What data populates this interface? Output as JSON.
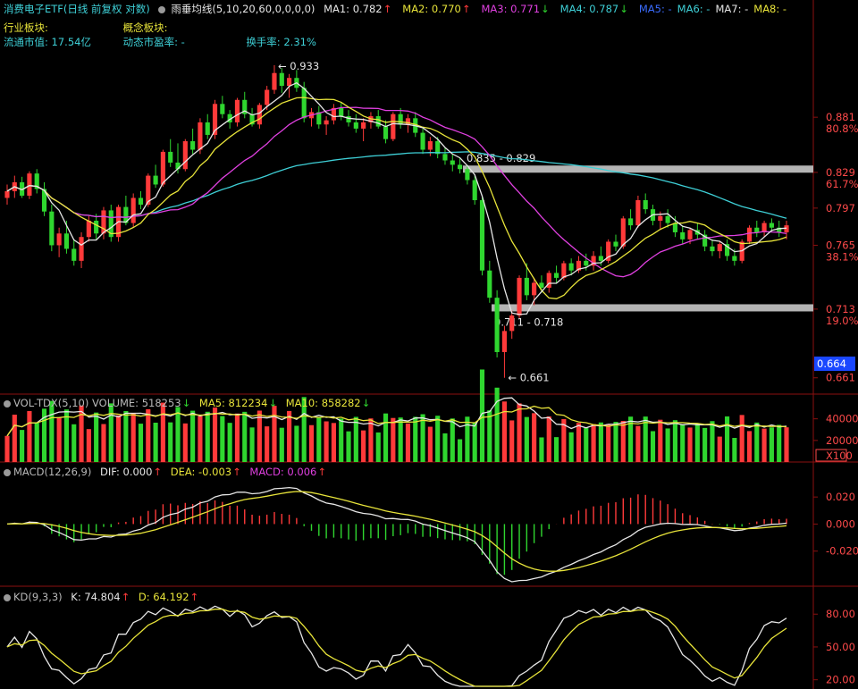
{
  "header": {
    "title": "消费电子ETF",
    "mode": "(日线 前复权 对数)",
    "indicator": "雨垂均线",
    "params": "(5,10,20,60,0,0,0,0)",
    "ma": [
      {
        "label": "MA1: 0.782",
        "arrow": "↑",
        "color": "#e6e6e6"
      },
      {
        "label": "MA2: 0.770",
        "arrow": "↑",
        "color": "#e8e43a"
      },
      {
        "label": "MA3: 0.771",
        "arrow": "↓",
        "color": "#e040e0"
      },
      {
        "label": "MA4: 0.787",
        "arrow": "↓",
        "color": "#3ecfd6"
      },
      {
        "label": "MA5: -",
        "arrow": "",
        "color": "#3a6cff"
      },
      {
        "label": "MA6: -",
        "arrow": "",
        "color": "#3ecfd6"
      },
      {
        "label": "MA7: -",
        "arrow": "",
        "color": "#e6e6e6"
      },
      {
        "label": "MA8: -",
        "arrow": "",
        "color": "#e8e43a"
      }
    ],
    "industry_label": "行业板块:",
    "concept_label": "概念板块:",
    "circ_mv": "流通市值: 17.54亿",
    "dyn_pe": "动态市盈率: -",
    "turnover": "换手率: 2.31%"
  },
  "price_axis": {
    "levels": [
      {
        "price": "0.881",
        "fib": "80.8%"
      },
      {
        "price": "0.829",
        "fib": "61.7%"
      },
      {
        "price": "0.797",
        "fib": ""
      },
      {
        "price": "0.765",
        "fib": "38.1%"
      },
      {
        "price": "0.713",
        "fib": "19.0%"
      },
      {
        "price": "0.661",
        "fib": ""
      }
    ],
    "current_price": "0.664"
  },
  "annotations": {
    "high": "0.933",
    "low": "0.661",
    "zone_upper": "0.835 - 0.829",
    "zone_lower": "0.711 - 0.718"
  },
  "volume_panel": {
    "name": "VOL-TDX(5,10)",
    "volume": "VOLUME: 518253",
    "volume_arrow": "↓",
    "ma5": "MA5: 812234",
    "ma5_arrow": "↓",
    "ma10": "MA10: 858282",
    "ma10_arrow": "↓",
    "ticks": [
      "40000",
      "20000"
    ],
    "unit": "X100"
  },
  "macd_panel": {
    "name": "MACD(12,26,9)",
    "dif": "DIF: 0.000",
    "dif_arrow": "↑",
    "dea": "DEA: -0.003",
    "dea_arrow": "↑",
    "macd": "MACD: 0.006",
    "macd_arrow": "↑",
    "ticks": [
      "0.020",
      "0.000",
      "-0.020"
    ]
  },
  "kd_panel": {
    "name": "KD(9,3,3)",
    "k": "K: 74.804",
    "k_arrow": "↑",
    "d": "D: 64.192",
    "d_arrow": "↑",
    "ticks": [
      "80.00",
      "50.00",
      "20.00"
    ]
  },
  "colors": {
    "up": "#ff3a3a",
    "down": "#2fd62f",
    "ma5": "#e6e6e6",
    "ma10": "#e8e43a",
    "ma20": "#e040e0",
    "ma60": "#3ecfd6",
    "grid_red": "#8b1010",
    "zone": "#b4b4b4"
  },
  "chart_data": {
    "type": "candlestick",
    "note_units": "price in CNY; candles listed left to right",
    "candles": [
      [
        0.806,
        0.818,
        0.8,
        0.812
      ],
      [
        0.812,
        0.826,
        0.806,
        0.82
      ],
      [
        0.82,
        0.825,
        0.806,
        0.808
      ],
      [
        0.808,
        0.83,
        0.805,
        0.828
      ],
      [
        0.828,
        0.832,
        0.81,
        0.814
      ],
      [
        0.814,
        0.82,
        0.79,
        0.794
      ],
      [
        0.794,
        0.8,
        0.76,
        0.765
      ],
      [
        0.765,
        0.78,
        0.755,
        0.775
      ],
      [
        0.775,
        0.786,
        0.758,
        0.762
      ],
      [
        0.762,
        0.77,
        0.748,
        0.752
      ],
      [
        0.752,
        0.776,
        0.746,
        0.772
      ],
      [
        0.772,
        0.79,
        0.768,
        0.786
      ],
      [
        0.786,
        0.792,
        0.77,
        0.775
      ],
      [
        0.775,
        0.798,
        0.77,
        0.795
      ],
      [
        0.795,
        0.8,
        0.768,
        0.772
      ],
      [
        0.772,
        0.8,
        0.768,
        0.798
      ],
      [
        0.798,
        0.808,
        0.782,
        0.784
      ],
      [
        0.784,
        0.81,
        0.78,
        0.806
      ],
      [
        0.806,
        0.812,
        0.796,
        0.8
      ],
      [
        0.8,
        0.828,
        0.798,
        0.826
      ],
      [
        0.826,
        0.836,
        0.815,
        0.818
      ],
      [
        0.818,
        0.85,
        0.816,
        0.848
      ],
      [
        0.848,
        0.86,
        0.834,
        0.838
      ],
      [
        0.838,
        0.856,
        0.828,
        0.832
      ],
      [
        0.832,
        0.86,
        0.83,
        0.858
      ],
      [
        0.858,
        0.87,
        0.846,
        0.85
      ],
      [
        0.85,
        0.88,
        0.846,
        0.876
      ],
      [
        0.876,
        0.884,
        0.86,
        0.864
      ],
      [
        0.864,
        0.898,
        0.86,
        0.894
      ],
      [
        0.894,
        0.902,
        0.88,
        0.884
      ],
      [
        0.884,
        0.888,
        0.87,
        0.876
      ],
      [
        0.876,
        0.9,
        0.872,
        0.898
      ],
      [
        0.898,
        0.906,
        0.88,
        0.884
      ],
      [
        0.884,
        0.89,
        0.872,
        0.874
      ],
      [
        0.874,
        0.895,
        0.87,
        0.893
      ],
      [
        0.893,
        0.912,
        0.888,
        0.908
      ],
      [
        0.908,
        0.933,
        0.904,
        0.925
      ],
      [
        0.925,
        0.93,
        0.905,
        0.912
      ],
      [
        0.912,
        0.924,
        0.9,
        0.92
      ],
      [
        0.92,
        0.928,
        0.906,
        0.91
      ],
      [
        0.91,
        0.916,
        0.876,
        0.88
      ],
      [
        0.88,
        0.89,
        0.872,
        0.886
      ],
      [
        0.886,
        0.892,
        0.87,
        0.874
      ],
      [
        0.874,
        0.882,
        0.864,
        0.878
      ],
      [
        0.878,
        0.894,
        0.874,
        0.89
      ],
      [
        0.89,
        0.896,
        0.878,
        0.882
      ],
      [
        0.882,
        0.888,
        0.872,
        0.876
      ],
      [
        0.876,
        0.884,
        0.866,
        0.87
      ],
      [
        0.87,
        0.88,
        0.858,
        0.876
      ],
      [
        0.876,
        0.886,
        0.87,
        0.882
      ],
      [
        0.882,
        0.888,
        0.87,
        0.872
      ],
      [
        0.872,
        0.878,
        0.856,
        0.86
      ],
      [
        0.86,
        0.886,
        0.858,
        0.884
      ],
      [
        0.884,
        0.89,
        0.87,
        0.874
      ],
      [
        0.874,
        0.884,
        0.866,
        0.88
      ],
      [
        0.88,
        0.886,
        0.862,
        0.866
      ],
      [
        0.866,
        0.87,
        0.846,
        0.85
      ],
      [
        0.85,
        0.862,
        0.844,
        0.858
      ],
      [
        0.858,
        0.862,
        0.842,
        0.846
      ],
      [
        0.846,
        0.852,
        0.836,
        0.84
      ],
      [
        0.84,
        0.846,
        0.83,
        0.836
      ],
      [
        0.836,
        0.842,
        0.828,
        0.832
      ],
      [
        0.832,
        0.836,
        0.818,
        0.822
      ],
      [
        0.822,
        0.826,
        0.8,
        0.804
      ],
      [
        0.804,
        0.808,
        0.74,
        0.744
      ],
      [
        0.744,
        0.752,
        0.718,
        0.722
      ],
      [
        0.722,
        0.728,
        0.676,
        0.68
      ],
      [
        0.68,
        0.7,
        0.661,
        0.696
      ],
      [
        0.696,
        0.712,
        0.69,
        0.708
      ],
      [
        0.708,
        0.74,
        0.706,
        0.738
      ],
      [
        0.738,
        0.75,
        0.72,
        0.724
      ],
      [
        0.724,
        0.738,
        0.716,
        0.734
      ],
      [
        0.734,
        0.74,
        0.726,
        0.73
      ],
      [
        0.73,
        0.744,
        0.726,
        0.742
      ],
      [
        0.742,
        0.748,
        0.734,
        0.738
      ],
      [
        0.738,
        0.752,
        0.736,
        0.75
      ],
      [
        0.75,
        0.754,
        0.74,
        0.744
      ],
      [
        0.744,
        0.756,
        0.742,
        0.752
      ],
      [
        0.752,
        0.758,
        0.744,
        0.748
      ],
      [
        0.748,
        0.76,
        0.744,
        0.756
      ],
      [
        0.756,
        0.764,
        0.748,
        0.752
      ],
      [
        0.752,
        0.77,
        0.75,
        0.768
      ],
      [
        0.768,
        0.774,
        0.76,
        0.764
      ],
      [
        0.764,
        0.79,
        0.762,
        0.788
      ],
      [
        0.788,
        0.796,
        0.778,
        0.782
      ],
      [
        0.782,
        0.808,
        0.78,
        0.804
      ],
      [
        0.804,
        0.81,
        0.792,
        0.796
      ],
      [
        0.796,
        0.8,
        0.782,
        0.786
      ],
      [
        0.786,
        0.794,
        0.778,
        0.79
      ],
      [
        0.79,
        0.796,
        0.78,
        0.784
      ],
      [
        0.784,
        0.79,
        0.772,
        0.776
      ],
      [
        0.776,
        0.782,
        0.766,
        0.77
      ],
      [
        0.77,
        0.78,
        0.766,
        0.778
      ],
      [
        0.778,
        0.784,
        0.77,
        0.774
      ],
      [
        0.774,
        0.778,
        0.76,
        0.764
      ],
      [
        0.764,
        0.77,
        0.756,
        0.76
      ],
      [
        0.76,
        0.768,
        0.754,
        0.766
      ],
      [
        0.766,
        0.77,
        0.752,
        0.756
      ],
      [
        0.756,
        0.762,
        0.748,
        0.752
      ],
      [
        0.752,
        0.77,
        0.75,
        0.768
      ],
      [
        0.768,
        0.782,
        0.766,
        0.78
      ],
      [
        0.78,
        0.786,
        0.772,
        0.776
      ],
      [
        0.776,
        0.786,
        0.772,
        0.784
      ],
      [
        0.784,
        0.788,
        0.776,
        0.78
      ],
      [
        0.78,
        0.786,
        0.772,
        0.776
      ],
      [
        0.776,
        0.786,
        0.77,
        0.782
      ]
    ],
    "price_ticks": [
      0.881,
      0.829,
      0.797,
      0.765,
      0.713,
      0.661
    ],
    "volume_ticks": [
      40000,
      20000
    ],
    "macd_ticks": [
      0.02,
      0.0,
      -0.02
    ],
    "kd_ticks": [
      80,
      50,
      20
    ],
    "last": {
      "volume": 518253,
      "vol_ma5": 812234,
      "vol_ma10": 858282,
      "dif": 0.0,
      "dea": -0.003,
      "macd": 0.006,
      "k": 74.804,
      "d": 64.192
    }
  }
}
